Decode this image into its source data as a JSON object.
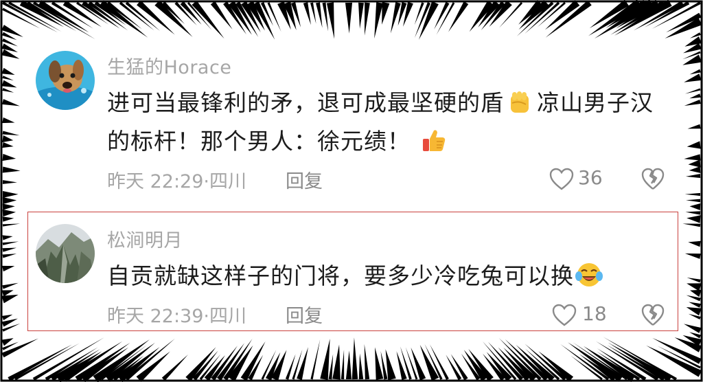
{
  "comments": [
    {
      "username": "生猛的Horace",
      "avatar_icon": "puppy-swimming-avatar",
      "text_part1": "进可当最锋利的矛，退可成最坚硬的盾",
      "emoji1": "raised-fist-emoji",
      "text_part2": "凉山男子汉的标杆！那个男人：徐元绩！",
      "emoji2": "thumbs-up-emoji",
      "meta": "昨天 22:29·四川",
      "reply_label": "回复",
      "likes": "36"
    },
    {
      "username": "松涧明月",
      "avatar_icon": "mountain-landscape-avatar",
      "text_part1": "自贡就缺这样子的门将，要多少冷吃兔可以换",
      "emoji1": "crying-laughing-emoji",
      "meta": "昨天 22:39·四川",
      "reply_label": "回复",
      "likes": "18",
      "highlighted": true
    }
  ],
  "colors": {
    "highlight_border": "#c9403c",
    "secondary_text": "#a6a6a6",
    "primary_text": "#1c1c1c"
  }
}
